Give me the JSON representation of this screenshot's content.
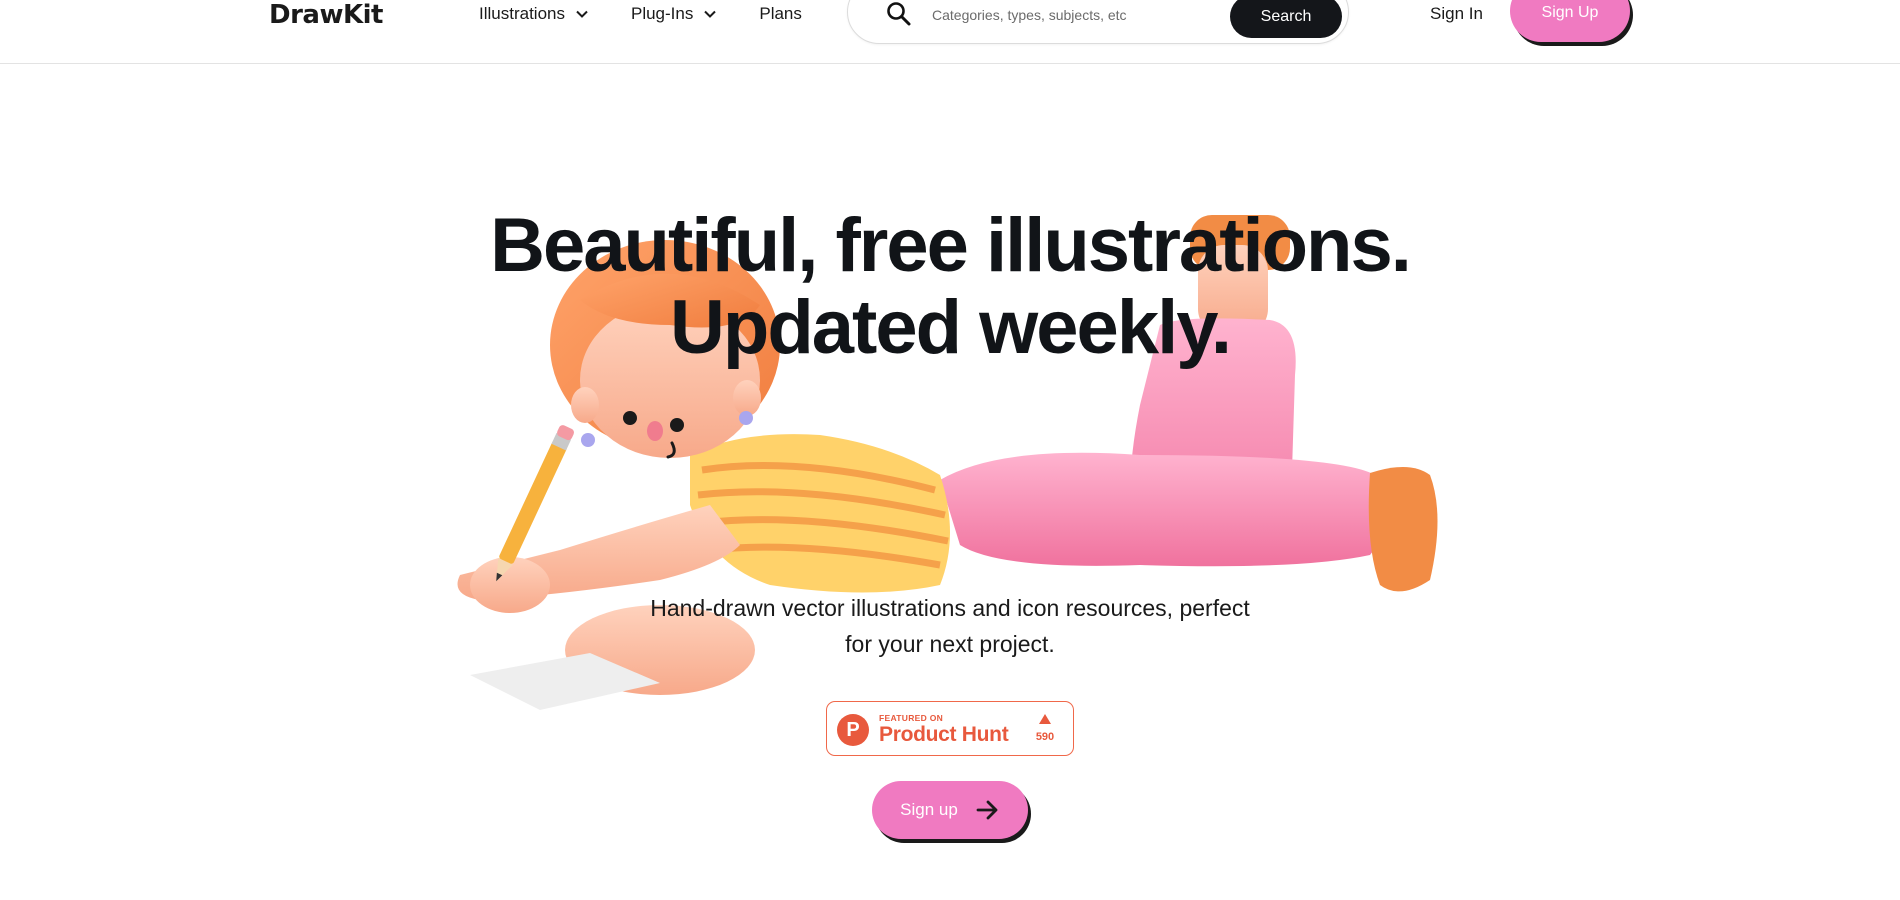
{
  "header": {
    "logo": "DrawKit",
    "nav": [
      {
        "label": "Illustrations",
        "dropdown": true
      },
      {
        "label": "Plug-Ins",
        "dropdown": true
      },
      {
        "label": "Plans",
        "dropdown": false
      }
    ],
    "search": {
      "placeholder": "Categories, types, subjects, etc",
      "button_label": "Search"
    },
    "sign_in_label": "Sign In",
    "sign_up_label": "Sign Up"
  },
  "hero": {
    "title_line1": "Beautiful, free illustrations.",
    "title_line2": "Updated weekly.",
    "subtitle_line1": "Hand-drawn vector illustrations and icon resources, perfect",
    "subtitle_line2": "for your next project.",
    "product_hunt": {
      "logo_letter": "P",
      "featured_label": "FEATURED ON",
      "name": "Product Hunt",
      "upvotes": "590"
    },
    "cta_label": "Sign up"
  },
  "colors": {
    "accent_pink": "#f07ac1",
    "dark": "#14161a",
    "product_hunt": "#e8593d"
  },
  "icons": {
    "search": "search-icon",
    "nav_dropdown": "chevron-down-icon",
    "cta_arrow": "arrow-right-icon",
    "product_hunt_upvote": "triangle-up-icon"
  }
}
